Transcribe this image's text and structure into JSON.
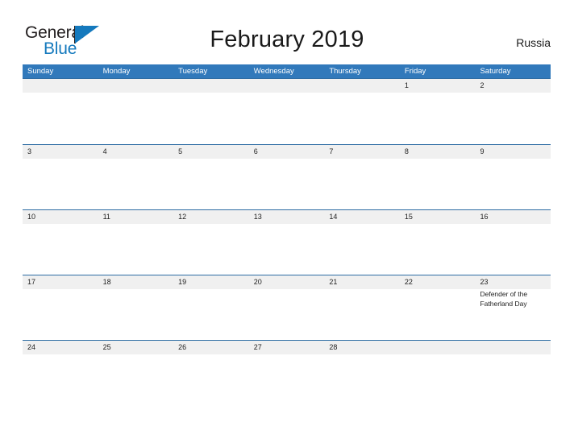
{
  "brand": {
    "name_part1": "General",
    "name_part2": "Blue",
    "triangle_icon": "blue-triangle-icon"
  },
  "header": {
    "title": "February 2019",
    "country": "Russia",
    "month": "February",
    "year": "2019"
  },
  "calendar": {
    "weekdays": [
      "Sunday",
      "Monday",
      "Tuesday",
      "Wednesday",
      "Thursday",
      "Friday",
      "Saturday"
    ],
    "colors": {
      "header_blue": "#3179bb",
      "rule_blue": "#2e6da4",
      "day_band_gray": "#f0f0f0",
      "brand_blue": "#1479bd",
      "text": "#222222"
    },
    "weeks": [
      [
        {
          "day": "",
          "events": []
        },
        {
          "day": "",
          "events": []
        },
        {
          "day": "",
          "events": []
        },
        {
          "day": "",
          "events": []
        },
        {
          "day": "",
          "events": []
        },
        {
          "day": "1",
          "events": []
        },
        {
          "day": "2",
          "events": []
        }
      ],
      [
        {
          "day": "3",
          "events": []
        },
        {
          "day": "4",
          "events": []
        },
        {
          "day": "5",
          "events": []
        },
        {
          "day": "6",
          "events": []
        },
        {
          "day": "7",
          "events": []
        },
        {
          "day": "8",
          "events": []
        },
        {
          "day": "9",
          "events": []
        }
      ],
      [
        {
          "day": "10",
          "events": []
        },
        {
          "day": "11",
          "events": []
        },
        {
          "day": "12",
          "events": []
        },
        {
          "day": "13",
          "events": []
        },
        {
          "day": "14",
          "events": []
        },
        {
          "day": "15",
          "events": []
        },
        {
          "day": "16",
          "events": []
        }
      ],
      [
        {
          "day": "17",
          "events": []
        },
        {
          "day": "18",
          "events": []
        },
        {
          "day": "19",
          "events": []
        },
        {
          "day": "20",
          "events": []
        },
        {
          "day": "21",
          "events": []
        },
        {
          "day": "22",
          "events": []
        },
        {
          "day": "23",
          "events": [
            "Defender of the Fatherland Day"
          ]
        }
      ],
      [
        {
          "day": "24",
          "events": []
        },
        {
          "day": "25",
          "events": []
        },
        {
          "day": "26",
          "events": []
        },
        {
          "day": "27",
          "events": []
        },
        {
          "day": "28",
          "events": []
        },
        {
          "day": "",
          "events": []
        },
        {
          "day": "",
          "events": []
        }
      ]
    ]
  }
}
